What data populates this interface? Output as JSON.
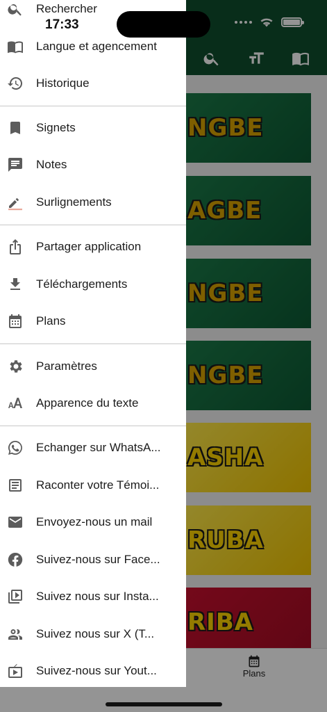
{
  "status": {
    "time": "17:33"
  },
  "drawer": {
    "items": [
      {
        "label": "Rechercher",
        "icon": "search-icon"
      },
      {
        "label": "Langue et agencement",
        "icon": "book-icon"
      },
      {
        "label": "Historique",
        "icon": "history-icon"
      },
      {
        "label": "Signets",
        "icon": "bookmark-icon"
      },
      {
        "label": "Notes",
        "icon": "notes-icon"
      },
      {
        "label": "Surlignements",
        "icon": "highlighter-icon"
      },
      {
        "label": "Partager application",
        "icon": "share-icon"
      },
      {
        "label": "Téléchargements",
        "icon": "download-icon"
      },
      {
        "label": "Plans",
        "icon": "calendar-icon"
      },
      {
        "label": "Paramètres",
        "icon": "gear-icon"
      },
      {
        "label": "Apparence du texte",
        "icon": "text-size-icon"
      },
      {
        "label": "Echanger sur WhatsA...",
        "icon": "whatsapp-icon"
      },
      {
        "label": "Raconter votre Témoi...",
        "icon": "document-icon"
      },
      {
        "label": "Envoyez-nous un mail",
        "icon": "mail-icon"
      },
      {
        "label": "Suivez-nous sur Face...",
        "icon": "facebook-icon"
      },
      {
        "label": "Suivez nous sur Insta...",
        "icon": "video-library-icon"
      },
      {
        "label": "Suivez nous sur X (T...",
        "icon": "people-icon"
      },
      {
        "label": "Suivez-nous sur Yout...",
        "icon": "youtube-icon"
      }
    ]
  },
  "background": {
    "cards": [
      "NGBE",
      "AGBE",
      "NGBE",
      "NGBE",
      "ASHA",
      "RUBA",
      "RIBA"
    ],
    "nav_label": "Plans"
  },
  "colors": {
    "header": "#0f4f2e",
    "card_green": "#1b7a48",
    "card_yellow": "#f2c500",
    "card_red": "#c8102e",
    "scrim": "rgba(0,0,0,0.42)"
  }
}
